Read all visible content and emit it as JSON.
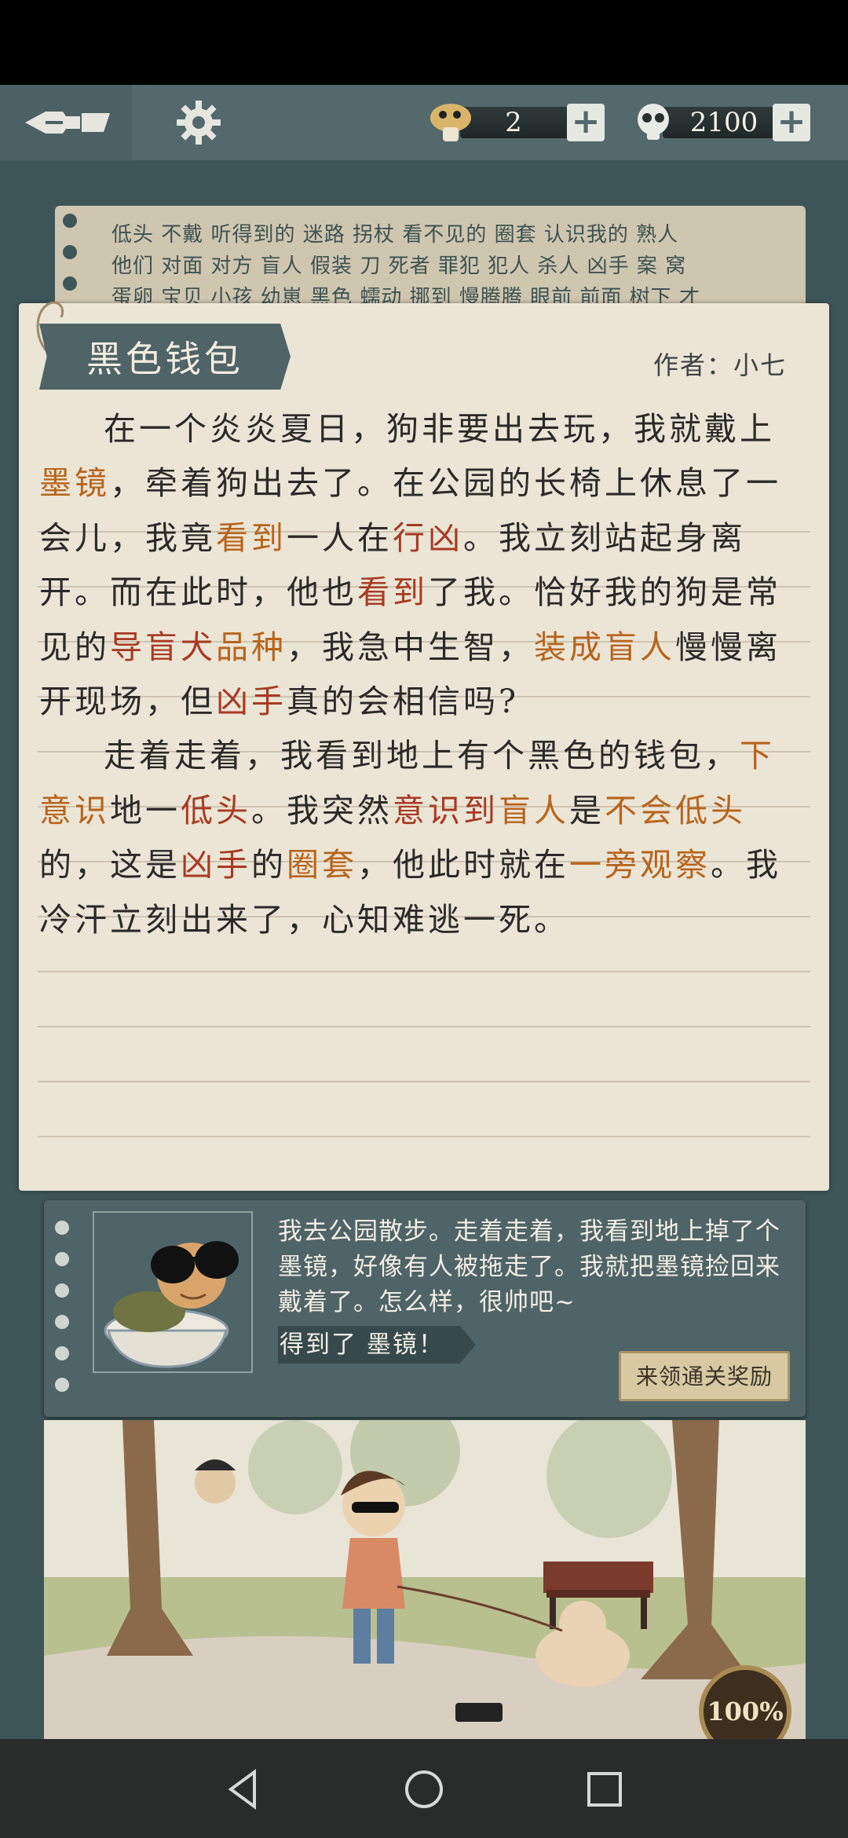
{
  "currencies": [
    {
      "icon": "mushroom-hint-icon",
      "value": "2",
      "plus": "+"
    },
    {
      "icon": "skull-coin-icon",
      "value": "2100",
      "plus": "+"
    }
  ],
  "word_list": {
    "row1": "低头 不戴 听得到的 迷路 拐杖 看不见的 圈套 认识我的 熟人",
    "row2": "他们 对面 对方 盲人 假装 刀 死者 罪犯 犯人 杀人 凶手 案 窝",
    "row3": "蛋卵 宝贝 小孩 幼崽 黑色 蠕动 挪到 慢腾腾 眼前 前面 树下 才"
  },
  "story": {
    "title": "黑色钱包",
    "author": "作者：小七",
    "p1": [
      {
        "t": "在一个炎炎夏日，狗非要出去玩，我就戴上",
        "c": ""
      },
      {
        "t": "墨镜",
        "c": "o"
      },
      {
        "t": "，牵着狗出去了。在公园的长椅上休息了一会儿，我竟",
        "c": ""
      },
      {
        "t": "看到",
        "c": "o"
      },
      {
        "t": "一人在",
        "c": ""
      },
      {
        "t": "行凶",
        "c": "r"
      },
      {
        "t": "。我立刻站起身离开。而在此时，他也",
        "c": ""
      },
      {
        "t": "看到",
        "c": "r"
      },
      {
        "t": "了我。恰好我的狗是常见的",
        "c": ""
      },
      {
        "t": "导盲犬",
        "c": "r"
      },
      {
        "t": "品种",
        "c": "o"
      },
      {
        "t": "，我急中生智，",
        "c": ""
      },
      {
        "t": "装成盲人",
        "c": "o"
      },
      {
        "t": "慢慢离开现场，但",
        "c": ""
      },
      {
        "t": "凶手",
        "c": "r"
      },
      {
        "t": "真的会相信吗?",
        "c": ""
      }
    ],
    "p2": [
      {
        "t": "走着走着，我看到地上有个黑色的钱包，",
        "c": ""
      },
      {
        "t": "下意识",
        "c": "o"
      },
      {
        "t": "地一",
        "c": ""
      },
      {
        "t": "低头",
        "c": "r"
      },
      {
        "t": "。我突然",
        "c": ""
      },
      {
        "t": "意识到",
        "c": "r"
      },
      {
        "t": "盲人",
        "c": "o"
      },
      {
        "t": "是",
        "c": ""
      },
      {
        "t": "不会低头",
        "c": "o"
      },
      {
        "t": "的，这是",
        "c": ""
      },
      {
        "t": "凶手",
        "c": "r"
      },
      {
        "t": "的",
        "c": ""
      },
      {
        "t": "圈套",
        "c": "o"
      },
      {
        "t": "，他此时就在",
        "c": ""
      },
      {
        "t": "一旁观察",
        "c": "o"
      },
      {
        "t": "。我冷汗立刻出来了，心知难逃一死。",
        "c": ""
      }
    ]
  },
  "reward": {
    "message": "我去公园散步。走着走着，我看到地上掉了个墨镜，好像有人被拖走了。我就把墨镜捡回来戴着了。怎么样，很帅吧~",
    "got_item": "得到了 墨镜！",
    "claim_button": "来领通关奖励"
  },
  "progress_badge": "100%",
  "colors": {
    "topbar": "#53696b",
    "paper": "#ebe5d6",
    "highlight_orange": "#b8641c",
    "highlight_red": "#a83a22"
  }
}
